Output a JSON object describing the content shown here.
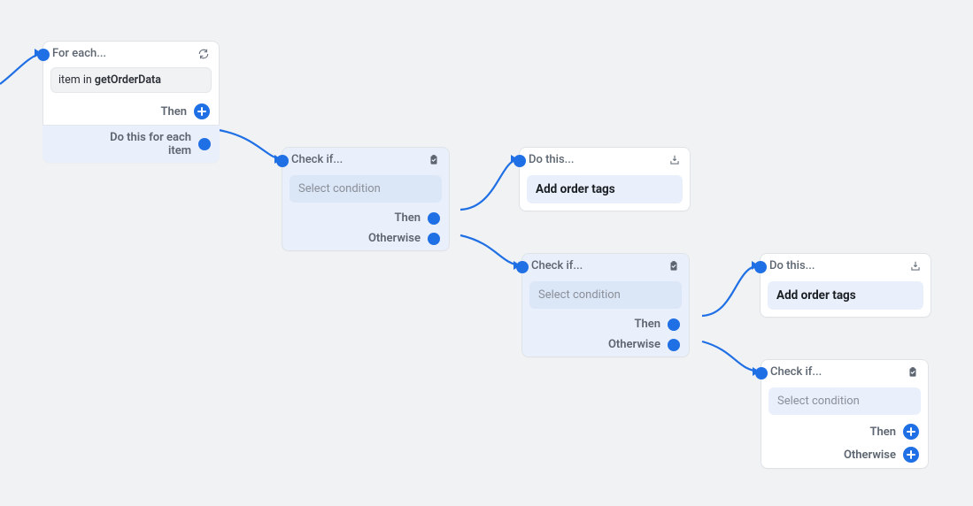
{
  "colors": {
    "accent": "#1f6fe5",
    "node_bg": "#ffffff",
    "node_blue_bg": "#eaf0fb",
    "canvas_bg": "#f1f2f4"
  },
  "forEach": {
    "title": "For each...",
    "item_prefix": "item in ",
    "item_source": "getOrderData",
    "then_label": "Then",
    "loop_label": "Do this for each item"
  },
  "check1": {
    "title": "Check if...",
    "placeholder": "Select condition",
    "then_label": "Then",
    "otherwise_label": "Otherwise"
  },
  "do1": {
    "title": "Do this...",
    "action_label": "Add order tags"
  },
  "check2": {
    "title": "Check if...",
    "placeholder": "Select condition",
    "then_label": "Then",
    "otherwise_label": "Otherwise"
  },
  "do2": {
    "title": "Do this...",
    "action_label": "Add order tags"
  },
  "check3": {
    "title": "Check if...",
    "placeholder": "Select condition",
    "then_label": "Then",
    "otherwise_label": "Otherwise"
  }
}
